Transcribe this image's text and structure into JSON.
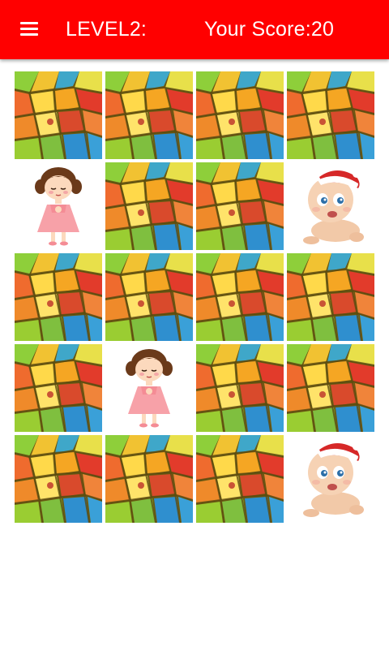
{
  "app_bar": {
    "menu_icon": "hamburger-menu-icon",
    "level_label": "LEVEL2:",
    "score_label": "Your Score:20",
    "color": "#ff0000"
  },
  "board": {
    "rows": 5,
    "cols": 4,
    "cards": [
      {
        "state": "face-down"
      },
      {
        "state": "face-down"
      },
      {
        "state": "face-down"
      },
      {
        "state": "face-down"
      },
      {
        "state": "face-up",
        "image": "girl"
      },
      {
        "state": "face-down"
      },
      {
        "state": "face-down"
      },
      {
        "state": "face-up",
        "image": "baby"
      },
      {
        "state": "face-down"
      },
      {
        "state": "face-down"
      },
      {
        "state": "face-down"
      },
      {
        "state": "face-down"
      },
      {
        "state": "face-down"
      },
      {
        "state": "face-up",
        "image": "girl"
      },
      {
        "state": "face-down"
      },
      {
        "state": "face-down"
      },
      {
        "state": "face-down"
      },
      {
        "state": "face-down"
      },
      {
        "state": "face-down"
      },
      {
        "state": "face-up",
        "image": "baby"
      }
    ]
  }
}
